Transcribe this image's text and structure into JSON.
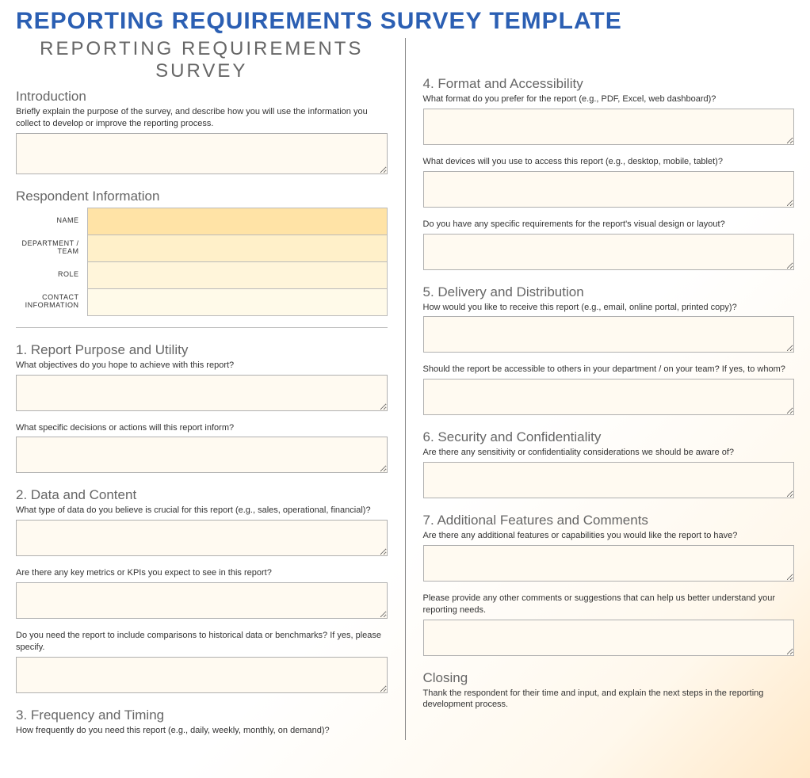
{
  "mainTitle": "REPORTING REQUIREMENTS SURVEY TEMPLATE",
  "surveyTitle": "REPORTING REQUIREMENTS SURVEY",
  "intro": {
    "heading": "Introduction",
    "desc": "Briefly explain the purpose of the survey, and describe how you will use the information you collect to develop or improve the reporting process."
  },
  "respondent": {
    "heading": "Respondent Information",
    "fields": [
      {
        "label": "NAME"
      },
      {
        "label": "DEPARTMENT / TEAM"
      },
      {
        "label": "ROLE"
      },
      {
        "label": "CONTACT INFORMATION"
      }
    ]
  },
  "s1": {
    "heading": "1. Report Purpose and Utility",
    "q1": "What objectives do you hope to achieve with this report?",
    "q2": "What specific decisions or actions will this report inform?"
  },
  "s2": {
    "heading": "2. Data and Content",
    "q1": "What type of data do you believe is crucial for this report (e.g., sales, operational, financial)?",
    "q2": "Are there any key metrics or KPIs you expect to see in this report?",
    "q3": "Do you need the report to include comparisons to historical data or benchmarks? If yes, please specify."
  },
  "s3": {
    "heading": "3. Frequency and Timing",
    "q1": "How frequently do you need this report (e.g., daily, weekly, monthly, on demand)?"
  },
  "s4": {
    "heading": "4. Format and Accessibility",
    "q1": "What format do you prefer for the report (e.g., PDF, Excel, web dashboard)?",
    "q2": "What devices will you use to access this report (e.g., desktop, mobile, tablet)?",
    "q3": "Do you have any specific requirements for the report's visual design or layout?"
  },
  "s5": {
    "heading": "5. Delivery and Distribution",
    "q1": "How would you like to receive this report (e.g., email, online portal, printed copy)?",
    "q2": "Should the report be accessible to others in your department / on your team? If yes, to whom?"
  },
  "s6": {
    "heading": "6. Security and Confidentiality",
    "q1": "Are there any sensitivity or confidentiality considerations we should be aware of?"
  },
  "s7": {
    "heading": "7. Additional Features and Comments",
    "q1": "Are there any additional features or capabilities you would like the report to have?",
    "q2": "Please provide any other comments or suggestions that can help us better understand your reporting needs."
  },
  "closing": {
    "heading": "Closing",
    "desc": "Thank the respondent for their time and input, and explain the next steps in the reporting development process."
  }
}
